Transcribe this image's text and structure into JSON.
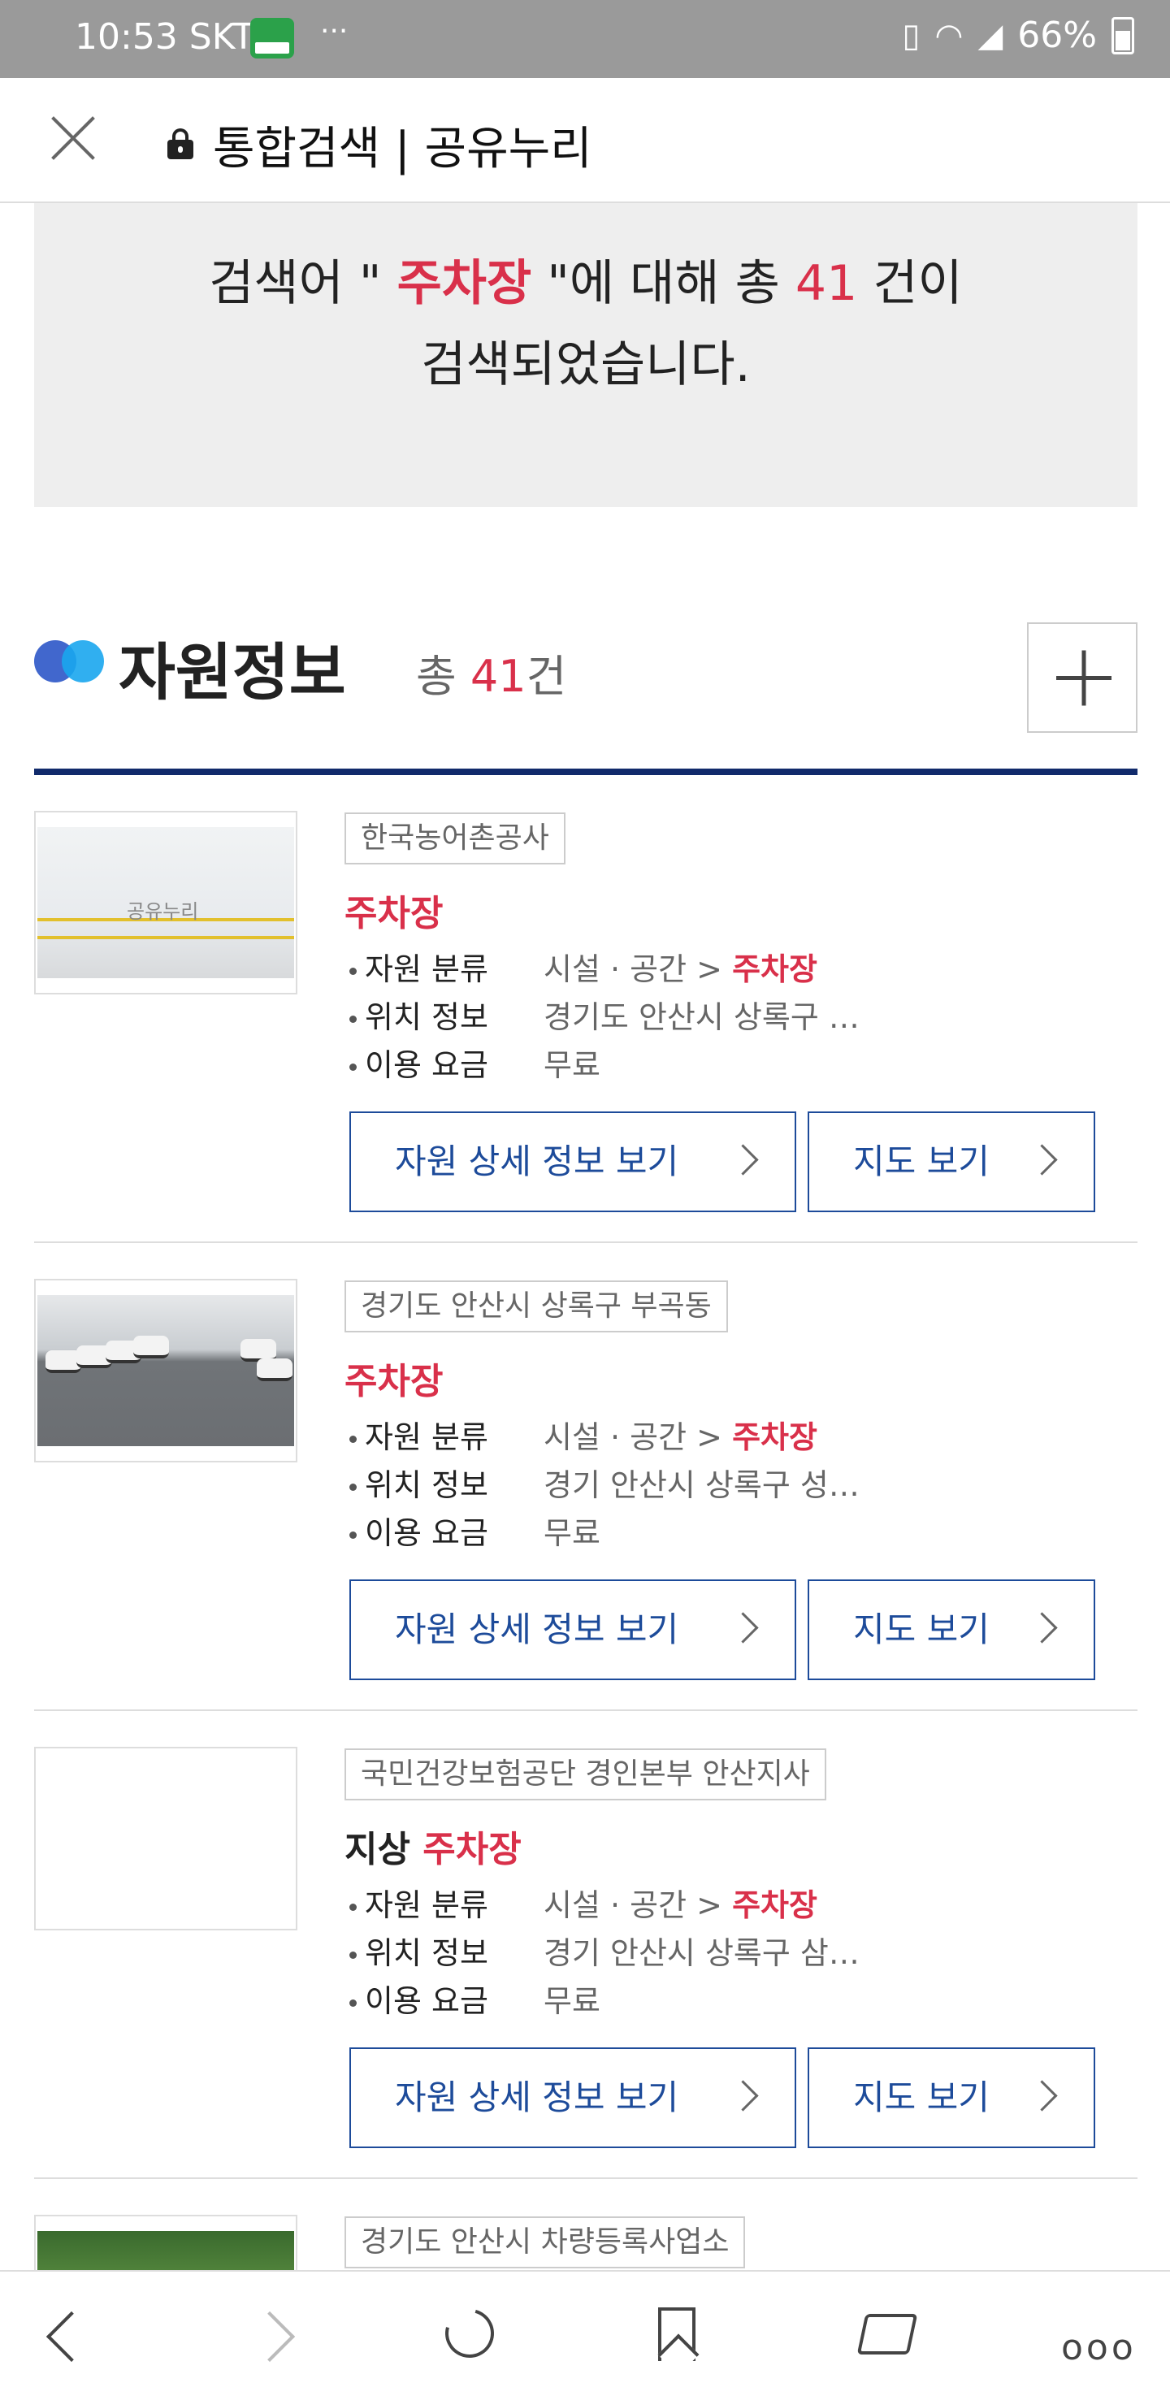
{
  "status_bar": {
    "time": "10:53 SKT",
    "notification_dots": "···",
    "battery": "66%"
  },
  "browser": {
    "title": "통합검색 | 공유누리"
  },
  "search_summary": {
    "prefix": "검색어 \"",
    "keyword": "주차장",
    "middle": "\"에 대해 총",
    "count": "41",
    "suffix": "건이",
    "line2": "검색되었습니다."
  },
  "section": {
    "title": "자원정보",
    "count_prefix": "총",
    "count": "41",
    "count_suffix": "건"
  },
  "labels": {
    "category": "자원 분류",
    "location": "위치 정보",
    "fee": "이용 요금",
    "detail_button": "자원 상세 정보 보기",
    "map_button": "지도 보기",
    "category_prefix": "시설 · 공간 >"
  },
  "results": [
    {
      "org": "한국농어촌공사",
      "title_prefix": "",
      "title_highlight": "주차장",
      "category_highlight": "주차장",
      "location": "경기도 안산시 상록구 …",
      "fee": "무료",
      "thumb_text": "공유누리"
    },
    {
      "org": "경기도 안산시 상록구 부곡동",
      "title_prefix": "",
      "title_highlight": "주차장",
      "category_highlight": "주차장",
      "location": "경기 안산시 상록구 성…",
      "fee": "무료"
    },
    {
      "org": "국민건강보험공단 경인본부 안산지사",
      "title_prefix": "지상 ",
      "title_highlight": "주차장",
      "category_highlight": "주차장",
      "location": "경기 안산시 상록구 삼…",
      "fee": "무료"
    },
    {
      "org": "경기도 안산시 차량등록사업소"
    }
  ],
  "bottom_nav": {
    "more": "ooo"
  }
}
